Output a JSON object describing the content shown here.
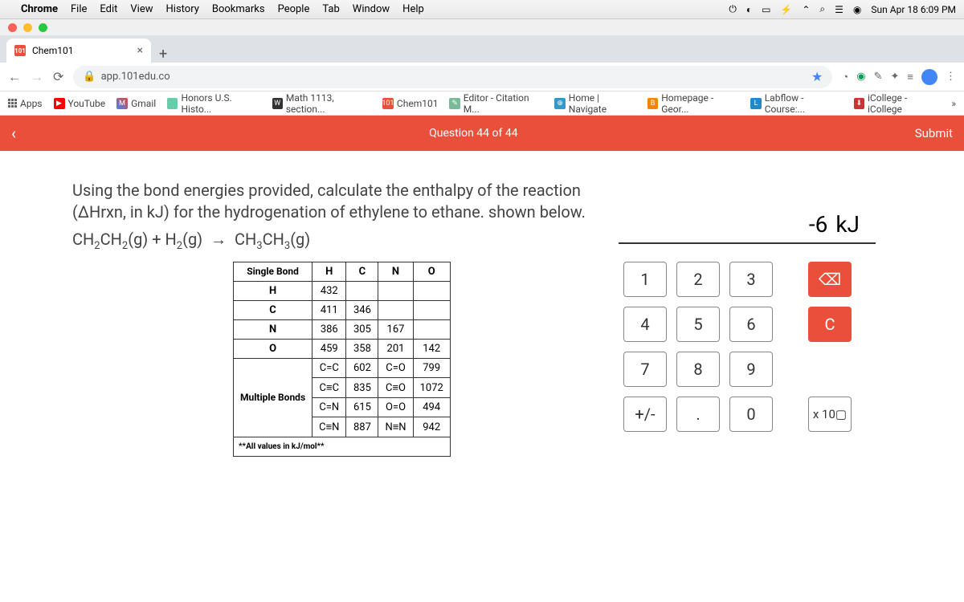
{
  "menubar": {
    "app": "Chrome",
    "items": [
      "File",
      "Edit",
      "View",
      "History",
      "Bookmarks",
      "People",
      "Tab",
      "Window",
      "Help"
    ],
    "clock": "Sun Apr 18  6:09 PM"
  },
  "tab": {
    "title": "Chem101"
  },
  "url": "app.101edu.co",
  "bookmarks": [
    "Apps",
    "YouTube",
    "Gmail",
    "Honors U.S. Histo...",
    "Math 1113, section...",
    "Chem101",
    "Editor - Citation M...",
    "Home | Navigate",
    "Homepage - Geor...",
    "Labflow - Course:...",
    "iCollege - iCollege"
  ],
  "question": {
    "number": "Question 44 of 44",
    "submit": "Submit",
    "text": "Using the bond energies provided, calculate the enthalpy of the reaction (ΔHrxn, in kJ) for the hydrogenation of ethylene to ethane. shown below."
  },
  "table": {
    "singleLabel": "Single Bond",
    "cols": [
      "H",
      "C",
      "N",
      "O"
    ],
    "rows": [
      {
        "l": "H",
        "v": [
          "432",
          "",
          "",
          ""
        ]
      },
      {
        "l": "C",
        "v": [
          "411",
          "346",
          "",
          ""
        ]
      },
      {
        "l": "N",
        "v": [
          "386",
          "305",
          "167",
          ""
        ]
      },
      {
        "l": "O",
        "v": [
          "459",
          "358",
          "201",
          "142"
        ]
      }
    ],
    "multiLabel": "Multiple Bonds",
    "multi": [
      [
        "C=C",
        "602",
        "C=O",
        "799"
      ],
      [
        "C≡C",
        "835",
        "C≡O",
        "1072"
      ],
      [
        "C=N",
        "615",
        "O=O",
        "494"
      ],
      [
        "C≡N",
        "887",
        "N≡N",
        "942"
      ]
    ],
    "note": "**All values in kJ/mol**"
  },
  "answer": {
    "value": "-6",
    "unit": "kJ"
  },
  "keys": {
    "1": "1",
    "2": "2",
    "3": "3",
    "4": "4",
    "5": "5",
    "6": "6",
    "7": "7",
    "8": "8",
    "9": "9",
    "0": "0",
    "pm": "+/-",
    "dot": ".",
    "bk": "⌫",
    "c": "C",
    "exp": "x 10▢"
  }
}
